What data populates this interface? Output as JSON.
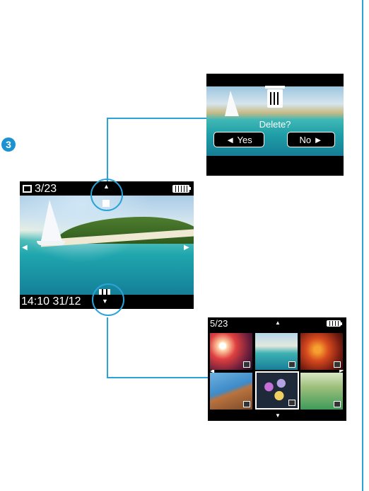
{
  "step": {
    "number": "3"
  },
  "main_screen": {
    "counter": "3/23",
    "timestamp": "14:10 31/12",
    "up_arrow": "▲",
    "down_arrow": "▼",
    "left_arrow": "◀",
    "right_arrow": "▶"
  },
  "delete_screen": {
    "question": "Delete?",
    "yes_label": "◄  Yes",
    "no_label": "No  ►"
  },
  "thumbnail_screen": {
    "counter": "5/23",
    "up_arrow": "▲",
    "down_arrow": "▼",
    "left_arrow": "◀",
    "right_arrow": "▶"
  },
  "colors": {
    "accent": "#2aa3d8",
    "badge": "#1c93d0",
    "screen_bg": "#000000"
  },
  "icons": [
    "film-icon",
    "battery-icon",
    "trash-icon",
    "grid-icon"
  ]
}
